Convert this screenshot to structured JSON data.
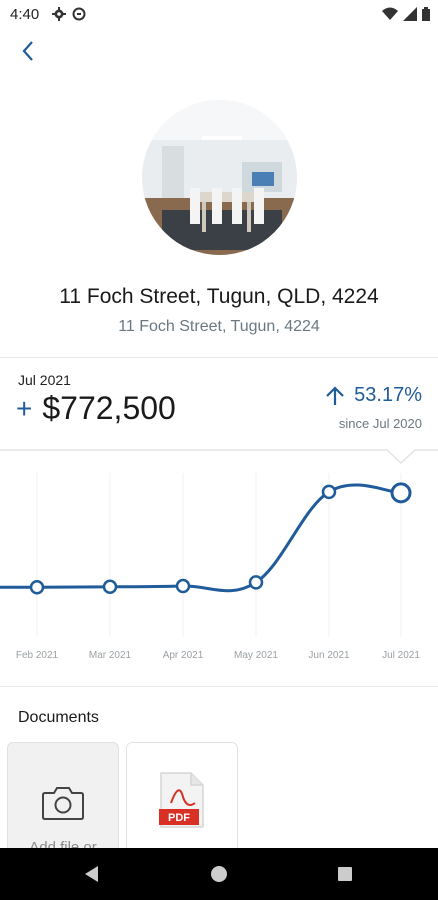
{
  "status_bar": {
    "time": "4:40"
  },
  "property": {
    "title": "11 Foch Street, Tugun, QLD, 4224",
    "subtitle": "11  Foch Street, Tugun, 4224"
  },
  "valuation": {
    "date": "Jul 2021",
    "plus": "+",
    "amount": "$772,500",
    "growth": "53.17%",
    "since": "since Jul 2020"
  },
  "chart_data": {
    "type": "line",
    "categories": [
      "Feb 2021",
      "Mar 2021",
      "Apr 2021",
      "May 2021",
      "Jun 2021",
      "Jul 2021"
    ],
    "x_labels": [
      "Feb 2021",
      "Mar 2021",
      "Apr 2021",
      "May 2021",
      "Jun 2021",
      "Jul 2021"
    ],
    "series": [
      {
        "values": [
          560000,
          561000,
          562500,
          570000,
          752000,
          750000
        ]
      }
    ],
    "ylim": [
      460000,
      790000
    ],
    "grid": true,
    "colors": {
      "line": "#1f5c99"
    }
  },
  "documents": {
    "title": "Documents",
    "add_label": "Add file or",
    "pdf_badge": "PDF"
  }
}
